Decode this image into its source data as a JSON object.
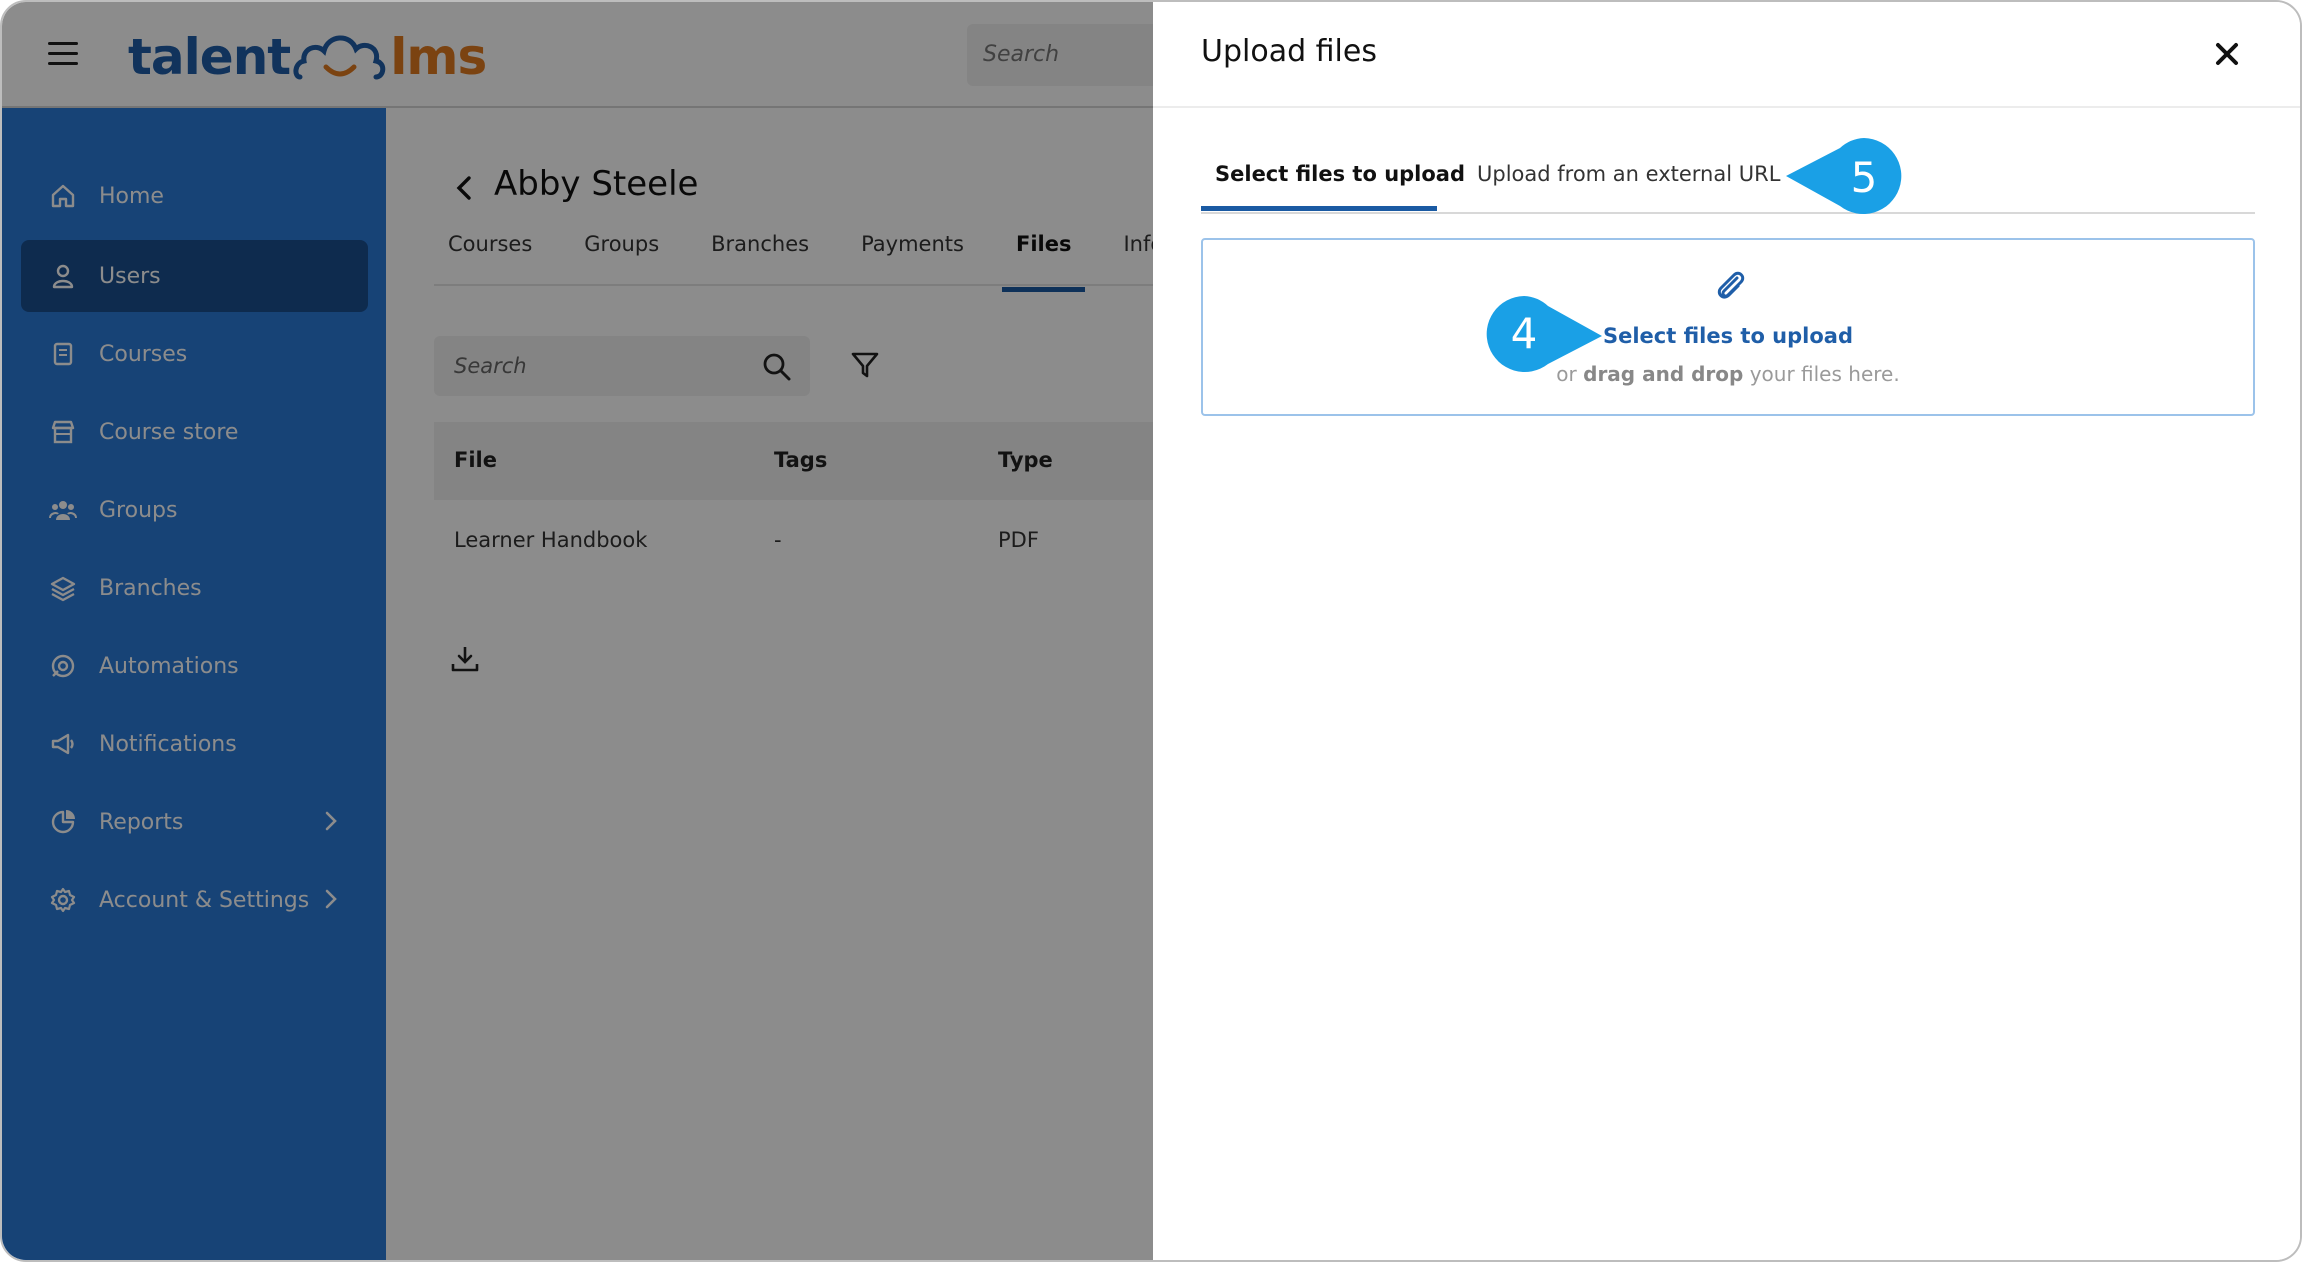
{
  "app": {
    "logo_left": "talent",
    "logo_right": "lms",
    "top_search_placeholder": "Search"
  },
  "sidebar": {
    "items": [
      {
        "label": "Home",
        "icon": "home-icon"
      },
      {
        "label": "Users",
        "icon": "user-icon",
        "active": true
      },
      {
        "label": "Courses",
        "icon": "book-icon"
      },
      {
        "label": "Course store",
        "icon": "store-icon"
      },
      {
        "label": "Groups",
        "icon": "groups-icon"
      },
      {
        "label": "Branches",
        "icon": "layers-icon"
      },
      {
        "label": "Automations",
        "icon": "automation-icon"
      },
      {
        "label": "Notifications",
        "icon": "megaphone-icon"
      },
      {
        "label": "Reports",
        "icon": "pie-chart-icon",
        "has_submenu": true
      },
      {
        "label": "Account & Settings",
        "icon": "gear-icon",
        "has_submenu": true
      }
    ]
  },
  "user_page": {
    "title": "Abby Steele",
    "tabs": [
      "Courses",
      "Groups",
      "Branches",
      "Payments",
      "Files",
      "Info"
    ],
    "active_tab": "Files",
    "search_placeholder": "Search",
    "table": {
      "headers": [
        "File",
        "Tags",
        "Type"
      ],
      "rows": [
        {
          "file": "Learner Handbook",
          "tags": "-",
          "type": "PDF"
        }
      ]
    }
  },
  "panel": {
    "title": "Upload files",
    "tabs": [
      "Select files to upload",
      "Upload from an external URL"
    ],
    "active_tab": "Select files to upload",
    "dropzone": {
      "link_text": "Select files to upload",
      "hint_prefix": "or",
      "hint_bold": "drag and drop",
      "hint_suffix": "your files here."
    }
  },
  "callouts": {
    "step_4": "4",
    "step_5": "5"
  },
  "colors": {
    "sidebar": "#2a7ad8",
    "sidebar_active": "#1a4f8f",
    "accent": "#1a5aa3",
    "callout": "#1aa0e6"
  }
}
